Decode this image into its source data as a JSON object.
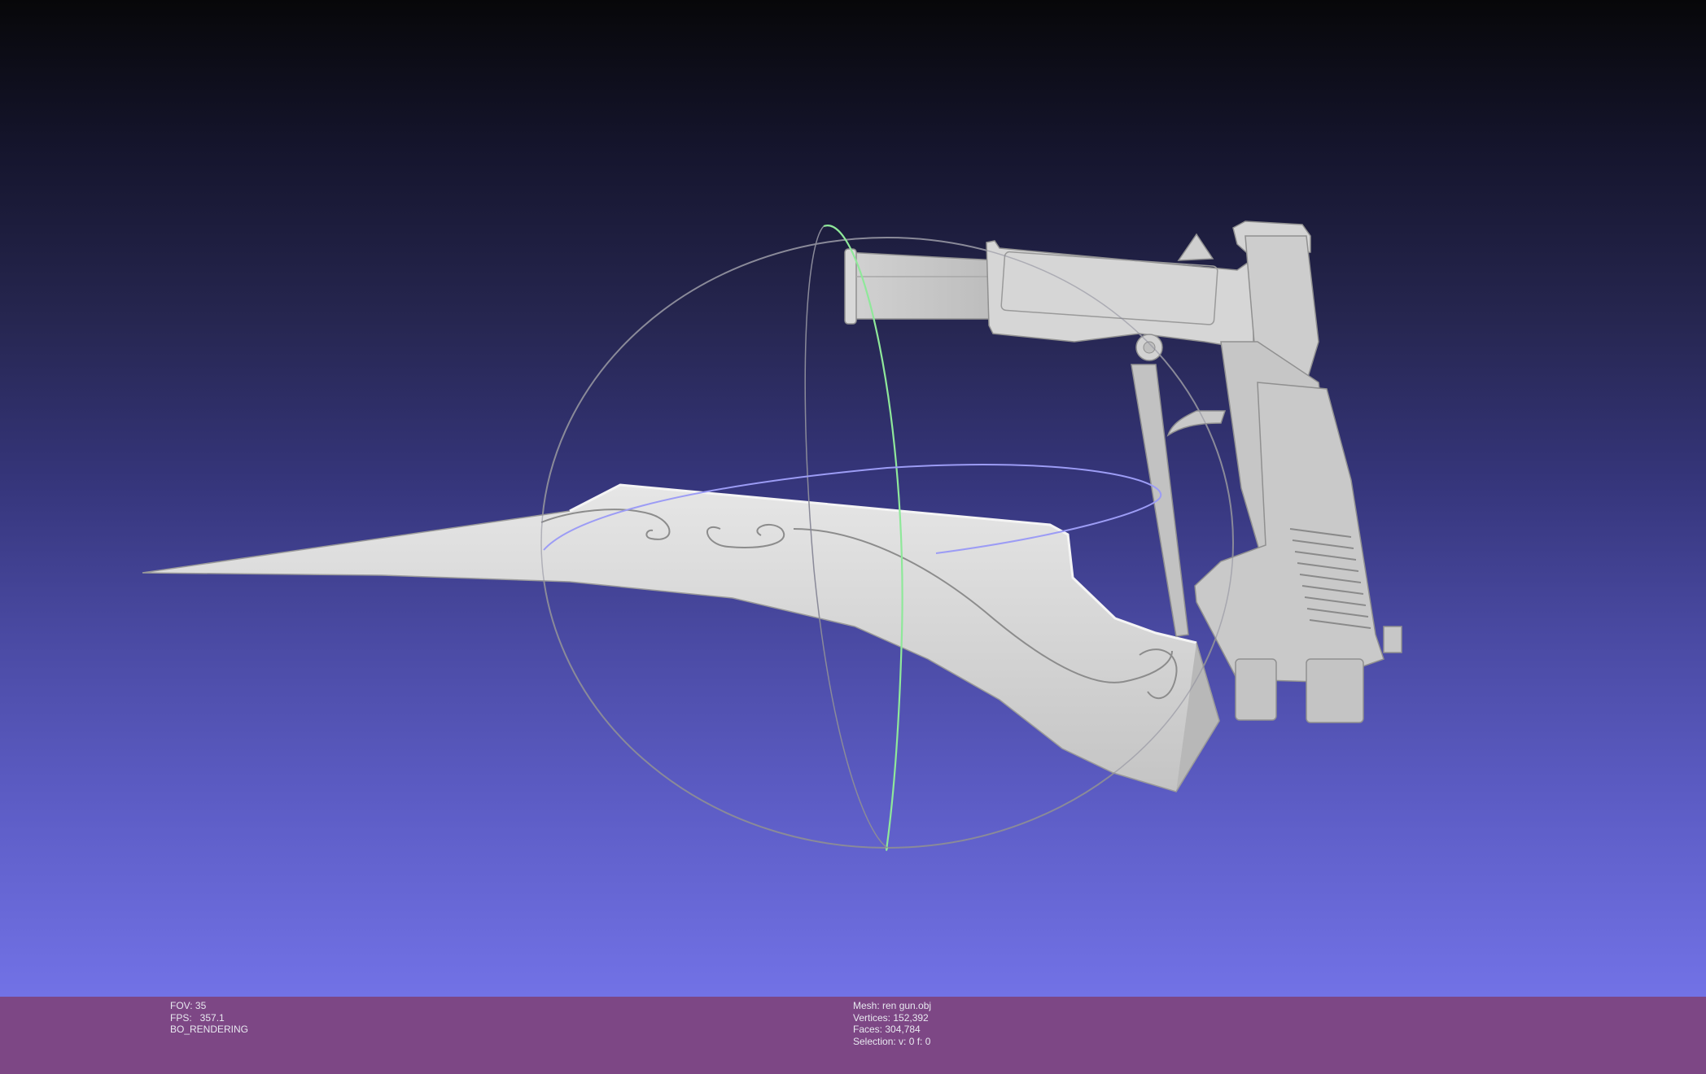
{
  "viewport": {
    "model": "sword-gun-mesh",
    "trackball": "trackball-gizmo"
  },
  "info": {
    "left": {
      "fov": "FOV: 35",
      "fps": "FPS:   357.1",
      "mode": "BO_RENDERING"
    },
    "right": {
      "mesh": "Mesh: ren gun.obj",
      "vertices": "Vertices: 152,392",
      "faces": "Faces: 304,784",
      "selection": "Selection: v: 0 f: 0"
    }
  }
}
